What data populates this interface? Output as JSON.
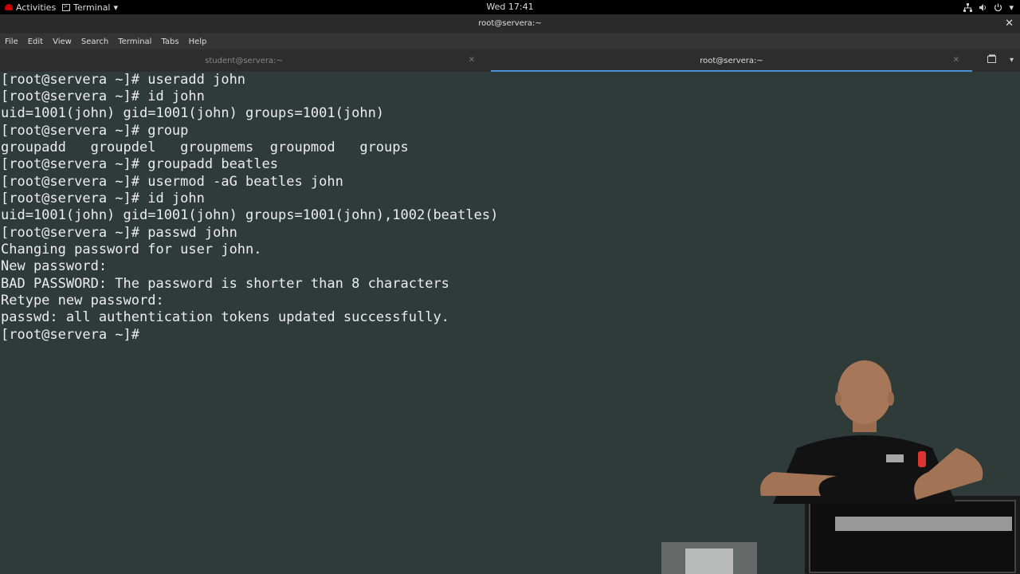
{
  "topbar": {
    "activities": "Activities",
    "app": "Terminal",
    "clock": "Wed 17:41"
  },
  "window": {
    "title": "root@servera:~"
  },
  "menu": [
    "File",
    "Edit",
    "View",
    "Search",
    "Terminal",
    "Tabs",
    "Help"
  ],
  "tabs": [
    {
      "label": "student@servera:~",
      "active": false
    },
    {
      "label": "root@servera:~",
      "active": true
    }
  ],
  "terminal": {
    "lines": [
      "[root@servera ~]# useradd john",
      "[root@servera ~]# id john",
      "uid=1001(john) gid=1001(john) groups=1001(john)",
      "[root@servera ~]# group",
      "groupadd   groupdel   groupmems  groupmod   groups",
      "[root@servera ~]# groupadd beatles",
      "[root@servera ~]# usermod -aG beatles john",
      "[root@servera ~]# id john",
      "uid=1001(john) gid=1001(john) groups=1001(john),1002(beatles)",
      "[root@servera ~]# passwd john",
      "Changing password for user john.",
      "New password:",
      "BAD PASSWORD: The password is shorter than 8 characters",
      "Retype new password:",
      "passwd: all authentication tokens updated successfully.",
      "[root@servera ~]# "
    ]
  },
  "colors": {
    "terminal_bg": "#2e3b39",
    "terminal_fg": "#ededed",
    "tab_accent": "#4a90d9"
  }
}
